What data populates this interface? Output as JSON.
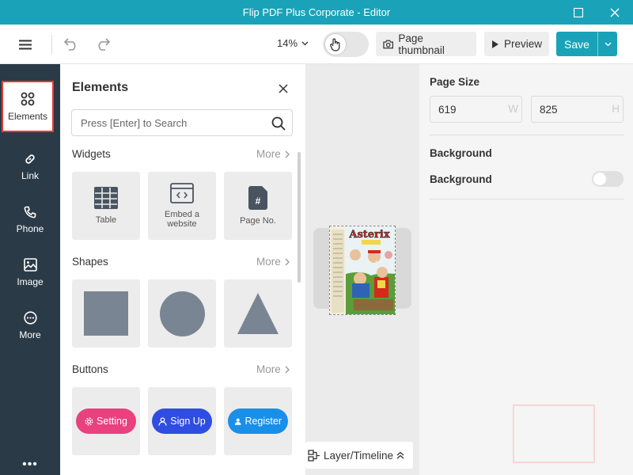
{
  "window": {
    "title": "Flip PDF Plus Corporate - Editor"
  },
  "toolbar": {
    "zoom": "14%",
    "page_thumbnail_label": "Page thumbnail",
    "preview_label": "Preview",
    "save_label": "Save"
  },
  "sidebar": {
    "items": [
      {
        "label": "Elements",
        "icon": "elements-icon"
      },
      {
        "label": "Link",
        "icon": "link-icon"
      },
      {
        "label": "Phone",
        "icon": "phone-icon"
      },
      {
        "label": "Image",
        "icon": "image-icon"
      },
      {
        "label": "More",
        "icon": "more-icon"
      }
    ],
    "overflow": "•••"
  },
  "panel": {
    "title": "Elements",
    "search_placeholder": "Press [Enter] to Search",
    "sections": [
      {
        "title": "Widgets",
        "more": "More",
        "tiles": [
          {
            "label": "Table",
            "icon": "table-icon"
          },
          {
            "label": "Embed a website",
            "icon": "embed-website-icon"
          },
          {
            "label": "Page No.",
            "icon": "page-number-icon"
          }
        ]
      },
      {
        "title": "Shapes",
        "more": "More",
        "tiles": [
          {
            "label": "",
            "icon": "square-shape"
          },
          {
            "label": "",
            "icon": "circle-shape"
          },
          {
            "label": "",
            "icon": "triangle-shape"
          }
        ]
      },
      {
        "title": "Buttons",
        "more": "More",
        "tiles": [
          {
            "label": "Setting",
            "color": "#e8417e"
          },
          {
            "label": "Sign Up",
            "color": "#2f4de0"
          },
          {
            "label": "Register",
            "color": "#1a8fe8"
          }
        ]
      }
    ]
  },
  "canvas": {
    "layer_timeline_label": "Layer/Timeline",
    "page_cover_title": "Asterix"
  },
  "properties": {
    "page_size_label": "Page Size",
    "width_value": "619",
    "width_unit": "W",
    "height_value": "825",
    "height_unit": "H",
    "background_heading": "Background",
    "background_toggle_label": "Background"
  },
  "colors": {
    "accent": "#1aa3b8",
    "sidebar_bg": "#2b3a47",
    "active_outline": "#e53935"
  }
}
